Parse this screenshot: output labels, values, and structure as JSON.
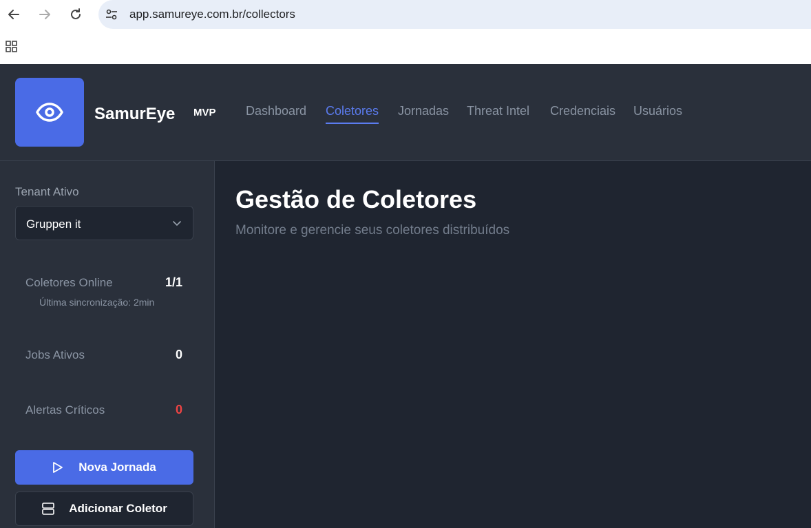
{
  "browser": {
    "url": "app.samureye.com.br/collectors"
  },
  "header": {
    "brand": "SamurEye",
    "badge": "MVP",
    "tabs": [
      {
        "label": "Dashboard",
        "active": false
      },
      {
        "label": "Coletores",
        "active": true
      },
      {
        "label": "Jornadas",
        "active": false
      },
      {
        "label": "Threat Intel",
        "active": false
      },
      {
        "label": "Credenciais",
        "active": false
      },
      {
        "label": "Usuários",
        "active": false
      }
    ]
  },
  "sidebar": {
    "tenant_label": "Tenant Ativo",
    "tenant_value": "Gruppen it",
    "stats": {
      "collectors_label": "Coletores Online",
      "collectors_value": "1/1",
      "sync_text": "Última sincronização: 2min",
      "jobs_label": "Jobs Ativos",
      "jobs_value": "0",
      "alerts_label": "Alertas Críticos",
      "alerts_value": "0"
    },
    "primary_button": "Nova Jornada",
    "secondary_button": "Adicionar Coletor"
  },
  "main": {
    "title": "Gestão de Coletores",
    "subtitle": "Monitore e gerencie seus coletores distribuídos"
  },
  "colors": {
    "accent": "#4a6be6",
    "panel": "#2a303b",
    "background": "#1f2530",
    "critical": "#ef4444"
  }
}
